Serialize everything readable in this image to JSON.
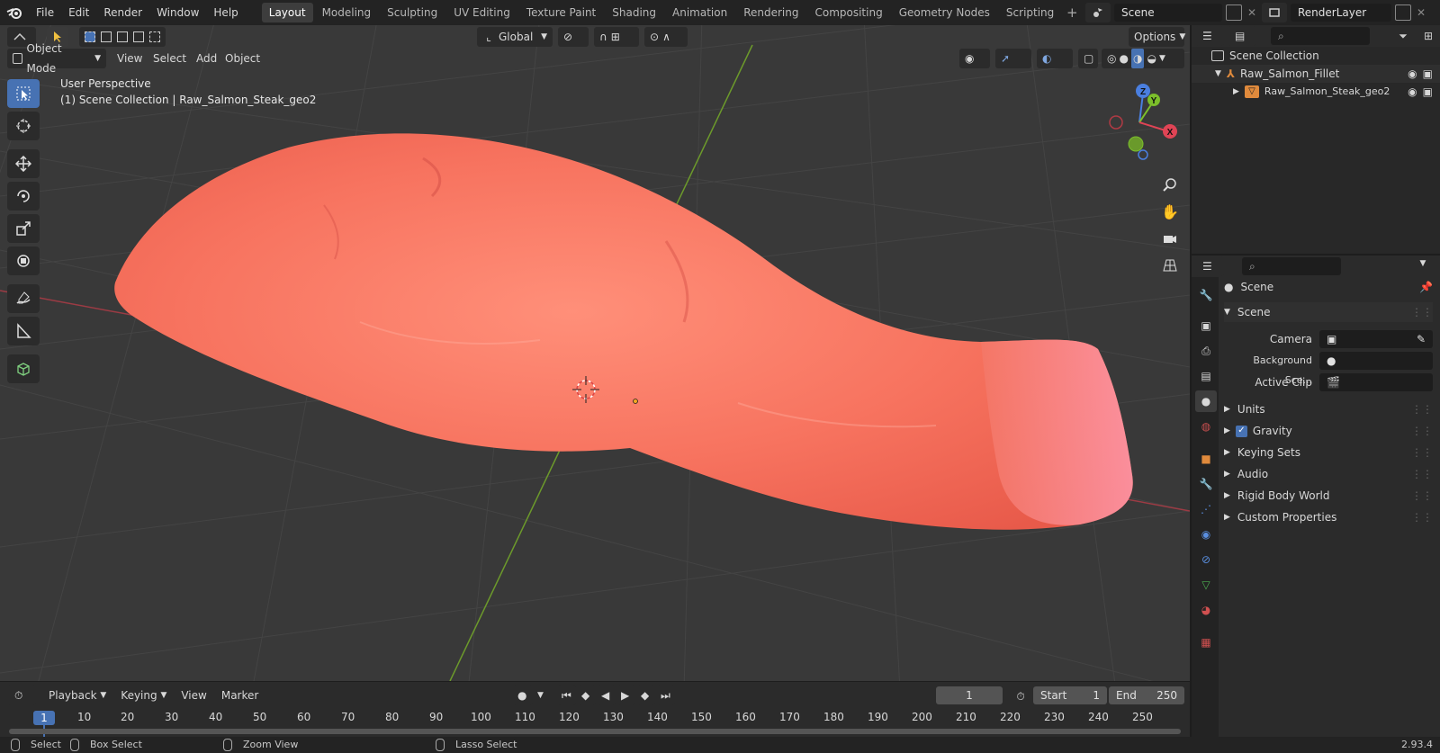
{
  "menu": [
    "File",
    "Edit",
    "Render",
    "Window",
    "Help"
  ],
  "workspaces": [
    {
      "label": "Layout",
      "active": true
    },
    {
      "label": "Modeling"
    },
    {
      "label": "Sculpting"
    },
    {
      "label": "UV Editing"
    },
    {
      "label": "Texture Paint"
    },
    {
      "label": "Shading"
    },
    {
      "label": "Animation"
    },
    {
      "label": "Rendering"
    },
    {
      "label": "Compositing"
    },
    {
      "label": "Geometry Nodes"
    },
    {
      "label": "Scripting"
    }
  ],
  "scene_name": "Scene",
  "render_layer": "RenderLayer",
  "viewport": {
    "transform_orientation": "Global",
    "options_label": "Options",
    "mode": "Object Mode",
    "menu": [
      "View",
      "Select",
      "Add",
      "Object"
    ],
    "overlay_line1": "User Perspective",
    "overlay_line2": "(1) Scene Collection | Raw_Salmon_Steak_geo2",
    "gizmo": {
      "z": "Z",
      "y": "Y",
      "x": "X"
    }
  },
  "outliner": {
    "root": "Scene Collection",
    "items": [
      {
        "label": "Raw_Salmon_Fillet"
      },
      {
        "label": "Raw_Salmon_Steak_geo2"
      }
    ]
  },
  "properties": {
    "header": "Scene",
    "panel_title": "Scene",
    "camera_label": "Camera",
    "background_label": "Background Sce...",
    "active_clip_label": "Active Clip",
    "sections": [
      "Units",
      "Gravity",
      "Keying Sets",
      "Audio",
      "Rigid Body World",
      "Custom Properties"
    ],
    "gravity_checked": true
  },
  "timeline": {
    "menu": [
      "Playback",
      "Keying",
      "View",
      "Marker"
    ],
    "current_frame": "1",
    "start_label": "Start",
    "start": "1",
    "end_label": "End",
    "end": "250",
    "ruler": [
      "1",
      "10",
      "20",
      "30",
      "40",
      "50",
      "60",
      "70",
      "80",
      "90",
      "100",
      "110",
      "120",
      "130",
      "140",
      "150",
      "160",
      "170",
      "180",
      "190",
      "200",
      "210",
      "220",
      "230",
      "240",
      "250"
    ]
  },
  "status": {
    "select": "Select",
    "box_select": "Box Select",
    "zoom_view": "Zoom View",
    "lasso_select": "Lasso Select",
    "version": "2.93.4"
  }
}
